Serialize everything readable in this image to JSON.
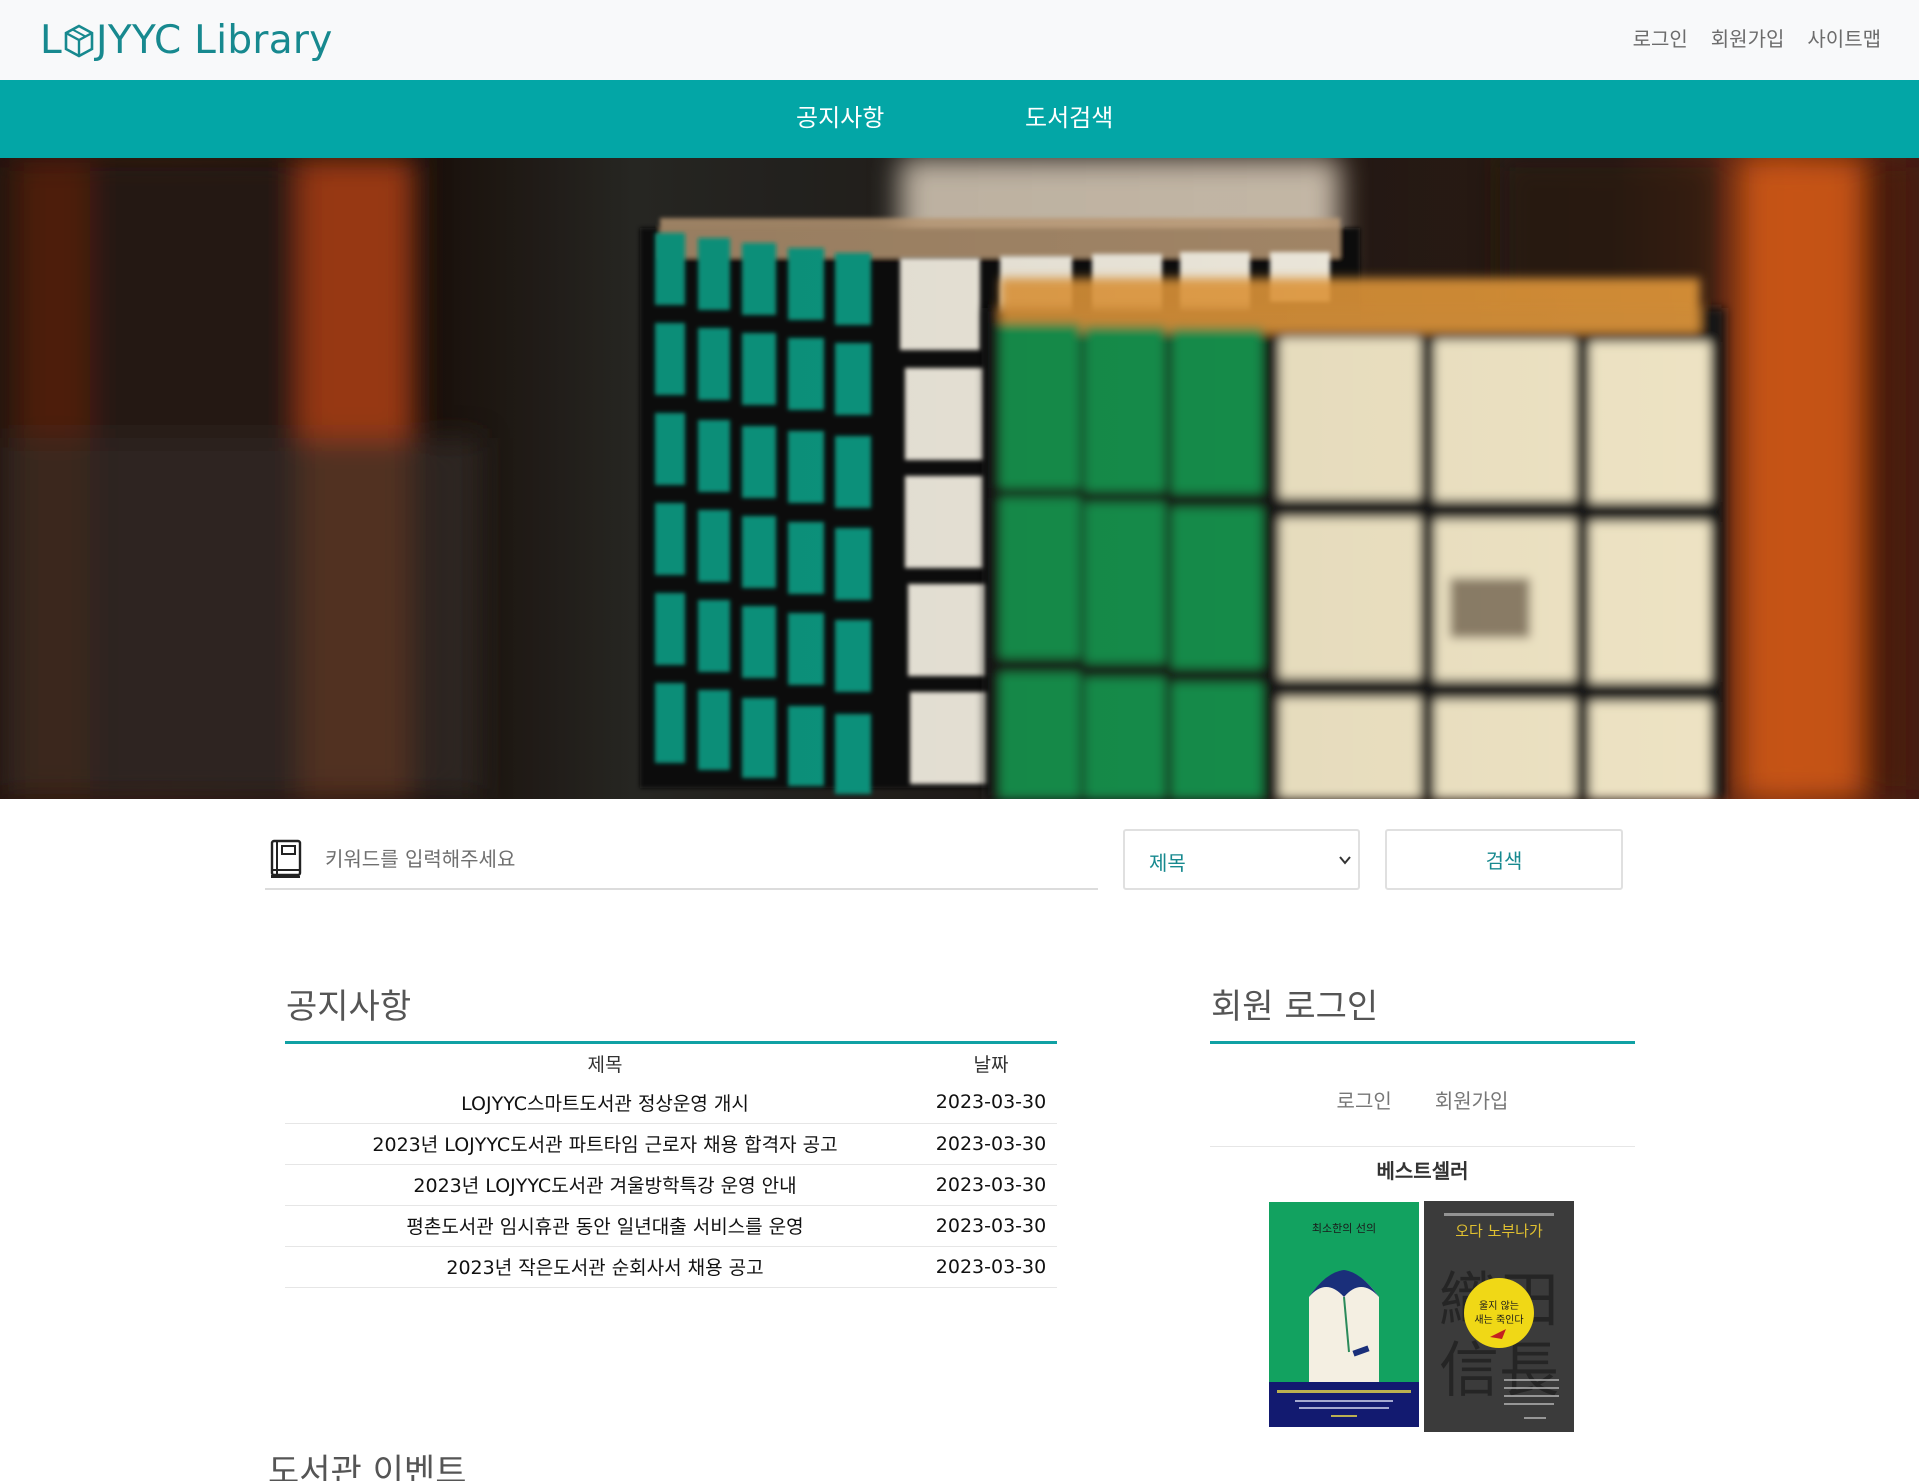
{
  "header": {
    "logo_text_left": "L",
    "logo_text_right": "JYYC Library",
    "links": [
      "로그인",
      "회원가입",
      "사이트맵"
    ]
  },
  "nav": {
    "items": [
      "공지사항",
      "도서검색"
    ]
  },
  "search": {
    "placeholder": "키워드를 입력해주세요",
    "select_value": "제목",
    "button_label": "검색"
  },
  "notice": {
    "title": "공지사항",
    "columns": [
      "제목",
      "날짜"
    ],
    "rows": [
      {
        "title": "LOJYYC스마트도서관 정상운영 개시",
        "date": "2023-03-30"
      },
      {
        "title": "2023년 LOJYYC도서관 파트타임 근로자 채용 합격자 공고",
        "date": "2023-03-30"
      },
      {
        "title": "2023년 LOJYYC도서관 겨울방학특강 운영 안내",
        "date": "2023-03-30"
      },
      {
        "title": "평촌도서관 임시휴관 동안 일년대출 서비스를 운영",
        "date": "2023-03-30"
      },
      {
        "title": "2023년 작은도서관 순회사서 채용 공고",
        "date": "2023-03-30"
      }
    ]
  },
  "login": {
    "title": "회원 로그인",
    "links": [
      "로그인",
      "회원가입"
    ]
  },
  "bestseller": {
    "title": "베스트셀러",
    "books": [
      {
        "cover_text": "최소한의 선의",
        "color": "#12a260"
      },
      {
        "cover_text_top": "오다 노부나가",
        "cover_badge": "울지 않는 새는 죽인다",
        "cover_big": "織田信長",
        "color": "#3b3b3b"
      }
    ]
  },
  "event": {
    "title": "도서관 이벤트"
  },
  "colors": {
    "brand": "#17898f",
    "nav_bg": "#03a6a6",
    "rule": "#10a1a4"
  }
}
